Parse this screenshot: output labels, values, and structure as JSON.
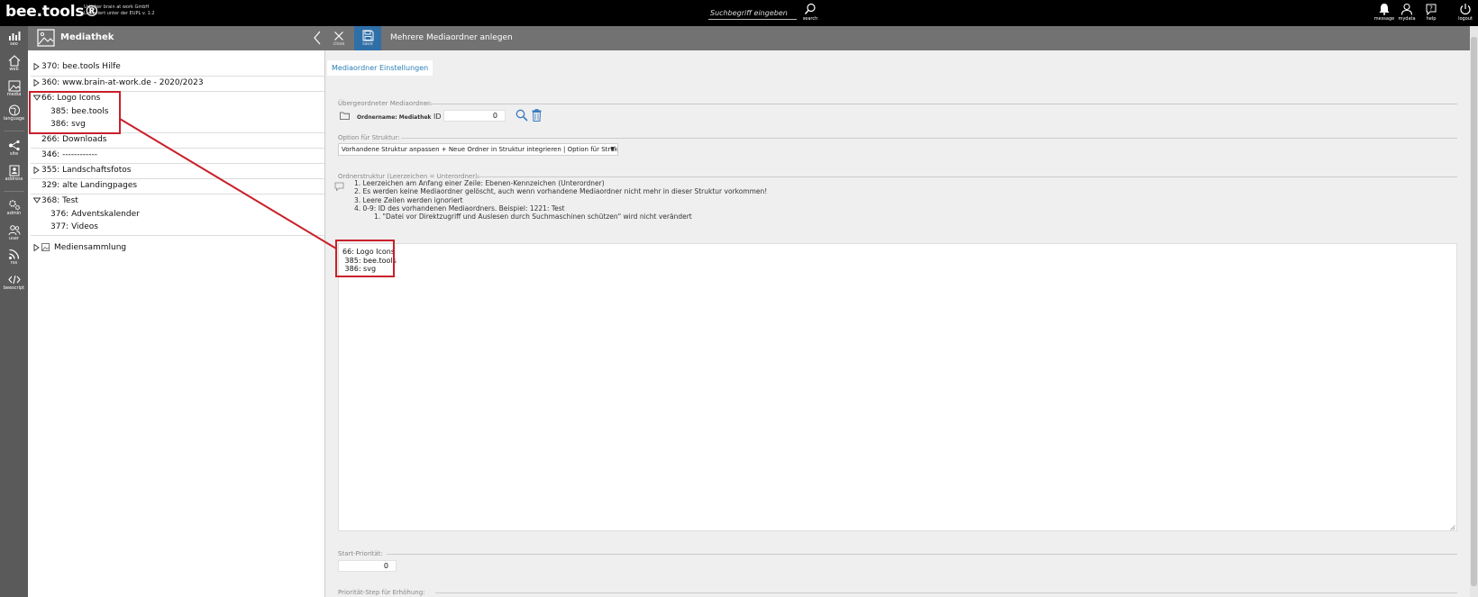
{
  "header": {
    "brand": "bee.tools®",
    "brand_sub1": "Urheber brain at work GmbH",
    "brand_sub2": "Lizenziert unter der EUPL v. 1.2",
    "search_placeholder": "Suchbegriff eingeben",
    "search_label": "search",
    "actions": [
      {
        "label": "message",
        "icon": "bell-icon"
      },
      {
        "label": "mydata",
        "icon": "user-icon"
      },
      {
        "label": "help",
        "icon": "help-icon"
      },
      {
        "label": "logout",
        "icon": "power-icon"
      }
    ]
  },
  "nav": [
    {
      "label": "seo",
      "icon": "bar-chart-icon"
    },
    {
      "label": "web",
      "icon": "home-icon"
    },
    {
      "label": "media",
      "icon": "image-icon"
    },
    {
      "label": "language",
      "icon": "globe-icon"
    },
    {
      "label": "site",
      "icon": "sitemap-icon"
    },
    {
      "label": "address",
      "icon": "address-icon"
    },
    {
      "label": "admin",
      "icon": "gears-icon"
    },
    {
      "label": "user",
      "icon": "users-icon"
    },
    {
      "label": "rss",
      "icon": "rss-icon"
    },
    {
      "label": "beescript",
      "icon": "code-icon"
    }
  ],
  "tree": {
    "title": "Mediathek",
    "items": [
      {
        "label": "370: bee.tools Hilfe",
        "level": 0,
        "toggle": "collapsed"
      },
      {
        "label": "360: www.brain-at-work.de - 2020/2023",
        "level": 0,
        "toggle": "collapsed"
      },
      {
        "label": "66: Logo Icons",
        "level": 0,
        "toggle": "expanded"
      },
      {
        "label": "385: bee.tools",
        "level": 1,
        "toggle": "none"
      },
      {
        "label": "386: svg",
        "level": 1,
        "toggle": "none"
      },
      {
        "label": "266: Downloads",
        "level": 0,
        "toggle": "none"
      },
      {
        "label": "346: ------------",
        "level": 0,
        "toggle": "none"
      },
      {
        "label": "355: Landschaftsfotos",
        "level": 0,
        "toggle": "collapsed"
      },
      {
        "label": "329: alte Landingpages",
        "level": 0,
        "toggle": "none"
      },
      {
        "label": "368: Test",
        "level": 0,
        "toggle": "expanded"
      },
      {
        "label": "376: Adventskalender",
        "level": 1,
        "toggle": "none"
      },
      {
        "label": "377: Videos",
        "level": 1,
        "toggle": "none"
      },
      {
        "label": "Mediensammlung",
        "level": 0,
        "toggle": "collapsed"
      }
    ]
  },
  "main": {
    "title": "Mehrere Mediaordner anlegen",
    "close_label": "close",
    "save_label": "save",
    "tab_label": "Mediaordner Einstellungen",
    "parent_legend": "Übergeordneter Mediaordner:",
    "folder_name_label": "Ordnername: Mediathek",
    "id_label": "ID",
    "id_value": "0",
    "structure_option_legend": "Option für Struktur:",
    "structure_option_value": "Vorhandene Struktur anpassen + Neue Ordner in Struktur integrieren | Option für Struktur",
    "structure_legend": "Ordnerstruktur (Leerzeichen = Unterordner):",
    "hints": [
      "1. Leerzeichen am Anfang einer Zeile: Ebenen-Kennzeichen (Unterordner)",
      "2. Es werden keine Mediaordner gelöscht, auch wenn vorhandene Mediaordner nicht mehr in dieser Struktur vorkommen!",
      "3. Leere Zeilen werden ignoriert",
      "4. 0-9: ID des vorhandenen Mediaordners. Beispiel: 1221: Test"
    ],
    "sub_hint": "1. \"Datei vor Direktzugriff und Auslesen durch Suchmaschinen schützen\" wird nicht verändert",
    "structure_text": "66: Logo Icons\n 385: bee.tools\n 386: svg",
    "start_priority_legend": "Start-Priorität:",
    "start_priority_value": "0",
    "priority_step_legend": "Priorität-Step für Erhöhung:"
  },
  "colors": {
    "topbar": "#000000",
    "nav": "#5a5a5a",
    "panel_header": "#727272",
    "save_button": "#2f6fa8",
    "tab_text": "#2a7fb5",
    "annotation": "#c8202a"
  }
}
